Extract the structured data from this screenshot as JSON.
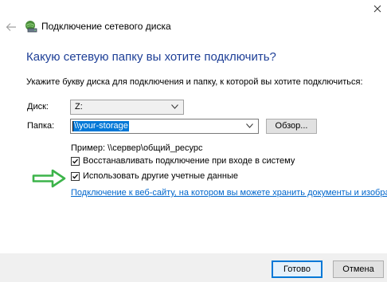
{
  "window": {
    "title": "Подключение сетевого диска"
  },
  "main": {
    "heading": "Какую сетевую папку вы хотите подключить?",
    "instruction": "Укажите букву диска для подключения и папку, к которой вы хотите подключиться:"
  },
  "form": {
    "drive_label": "Диск:",
    "drive_value": "Z:",
    "folder_label": "Папка:",
    "folder_value": "\\\\your-storage",
    "browse_label": "Обзор...",
    "example_text": "Пример: \\\\сервер\\общий_ресурс",
    "reconnect_label": "Восстанавливать подключение при входе в систему",
    "reconnect_checked": true,
    "credentials_label": "Использовать другие учетные данные",
    "credentials_checked": true,
    "link_text": "Подключение к веб-сайту, на котором вы можете хранить документы и изображения."
  },
  "footer": {
    "ok_label": "Готово",
    "cancel_label": "Отмена"
  },
  "colors": {
    "heading": "#1e3f97",
    "link": "#0066cc",
    "selection": "#0078d7",
    "annotation_arrow": "#3cb44a",
    "footer_bg": "#f0f0f0"
  },
  "icons": {
    "close": "close-icon",
    "back": "back-arrow-icon",
    "app": "network-drive-icon",
    "dropdown": "chevron-down-icon",
    "checkbox": "checkmark-icon",
    "annotation": "green-arrow-icon"
  }
}
